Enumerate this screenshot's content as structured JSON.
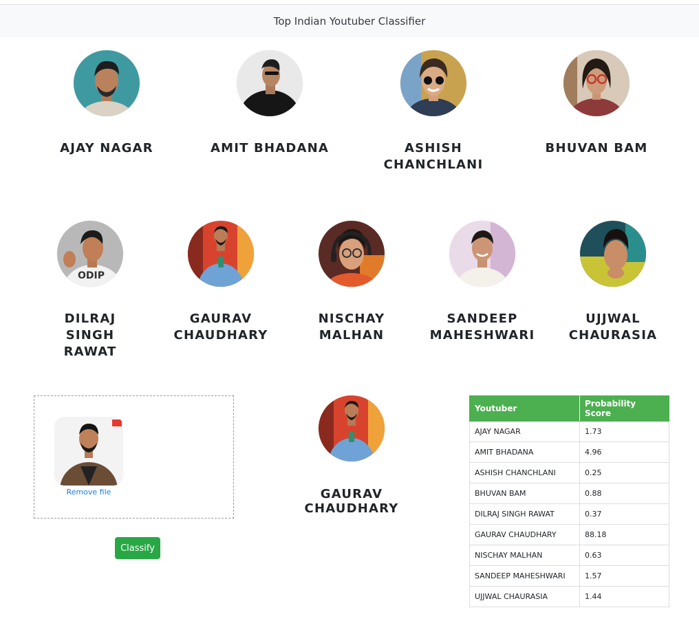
{
  "navbar": {
    "title": "Top Indian Youtuber Classifier"
  },
  "youtubers_row1": [
    {
      "name": "AJAY NAGAR",
      "icon": "ajay-nagar-photo"
    },
    {
      "name": "AMIT BHADANA",
      "icon": "amit-bhadana-photo"
    },
    {
      "name": "ASHISH CHANCHLANI",
      "icon": "ashish-chanchlani-photo"
    },
    {
      "name": "BHUVAN BAM",
      "icon": "bhuvan-bam-photo"
    }
  ],
  "youtubers_row2": [
    {
      "name": "DILRAJ SINGH RAWAT",
      "icon": "dilraj-singh-rawat-photo"
    },
    {
      "name": "GAURAV CHAUDHARY",
      "icon": "gaurav-chaudhary-photo"
    },
    {
      "name": "NISCHAY MALHAN",
      "icon": "nischay-malhan-photo"
    },
    {
      "name": "SANDEEP MAHESHWARI",
      "icon": "sandeep-maheshwari-photo"
    },
    {
      "name": "UJJWAL CHAURASIA",
      "icon": "ujjwal-chaurasia-photo"
    }
  ],
  "upload": {
    "remove_label": "Remove file",
    "classify_label": "Classify"
  },
  "result": {
    "name": "GAURAV CHAUDHARY"
  },
  "table": {
    "headers": [
      "Youtuber",
      "Probability Score"
    ],
    "rows": [
      [
        "AJAY NAGAR",
        "1.73"
      ],
      [
        "AMIT BHADANA",
        "4.96"
      ],
      [
        "ASHISH CHANCHLANI",
        "0.25"
      ],
      [
        "BHUVAN BAM",
        "0.88"
      ],
      [
        "DILRAJ SINGH RAWAT",
        "0.37"
      ],
      [
        "GAURAV CHAUDHARY",
        "88.18"
      ],
      [
        "NISCHAY MALHAN",
        "0.63"
      ],
      [
        "SANDEEP MAHESHWARI",
        "1.57"
      ],
      [
        "UJJWAL CHAURASIA",
        "1.44"
      ]
    ]
  },
  "colors": {
    "header_green": "#4caf50",
    "button_green": "#28a745",
    "link_blue": "#1f7bd6",
    "navbar_bg": "#f8f9fa"
  }
}
